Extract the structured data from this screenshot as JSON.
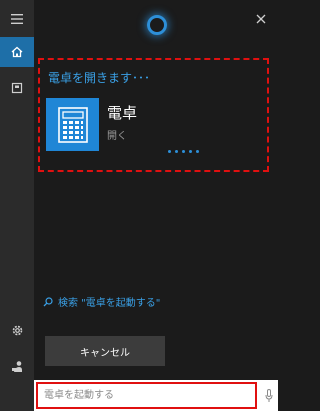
{
  "colors": {
    "accent": "#1e6fa8",
    "link": "#3aa0e6",
    "highlight": "#e01010",
    "sidebar_bg": "#2b2b2b",
    "panel_bg": "#1b1b1b"
  },
  "sidebar": {
    "items": [
      {
        "icon": "hamburger-menu-icon"
      },
      {
        "icon": "home-icon",
        "active": true
      },
      {
        "icon": "notebook-icon"
      },
      {
        "icon": "settings-gear-icon"
      },
      {
        "icon": "feedback-person-icon"
      }
    ]
  },
  "header": {
    "cortana_icon": "cortana-ring-icon",
    "close_icon": "close-icon"
  },
  "result": {
    "title": "電卓を開きます･･･",
    "app_name": "電卓",
    "app_subtitle": "開く",
    "app_icon": "calculator-icon"
  },
  "search_link": {
    "icon": "search-icon",
    "text": "検索 \"電卓を起動する\""
  },
  "cancel_button": {
    "label": "キャンセル"
  },
  "input": {
    "placeholder": "電卓を起動する",
    "mic_icon": "microphone-icon"
  }
}
